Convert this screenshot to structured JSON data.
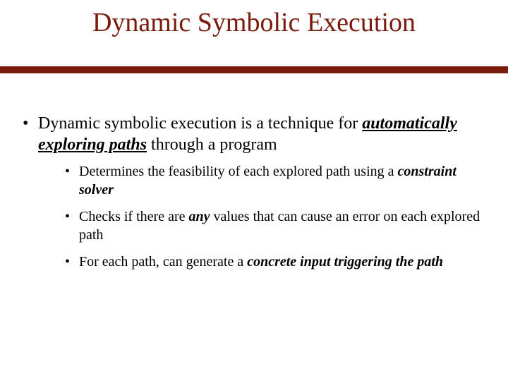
{
  "title": "Dynamic Symbolic Execution",
  "main": {
    "pre": "Dynamic symbolic execution is a technique for ",
    "em1": "automatically exploring paths",
    "post": " through a program"
  },
  "sub": [
    {
      "pre": "Determines the feasibility of each explored path using a ",
      "em": "constraint solver",
      "post": ""
    },
    {
      "pre": "Checks if there are ",
      "em": "any",
      "post": " values that can cause an error on each explored path"
    },
    {
      "pre": "For each path, can generate a ",
      "em": "concrete input triggering the path",
      "post": ""
    }
  ]
}
